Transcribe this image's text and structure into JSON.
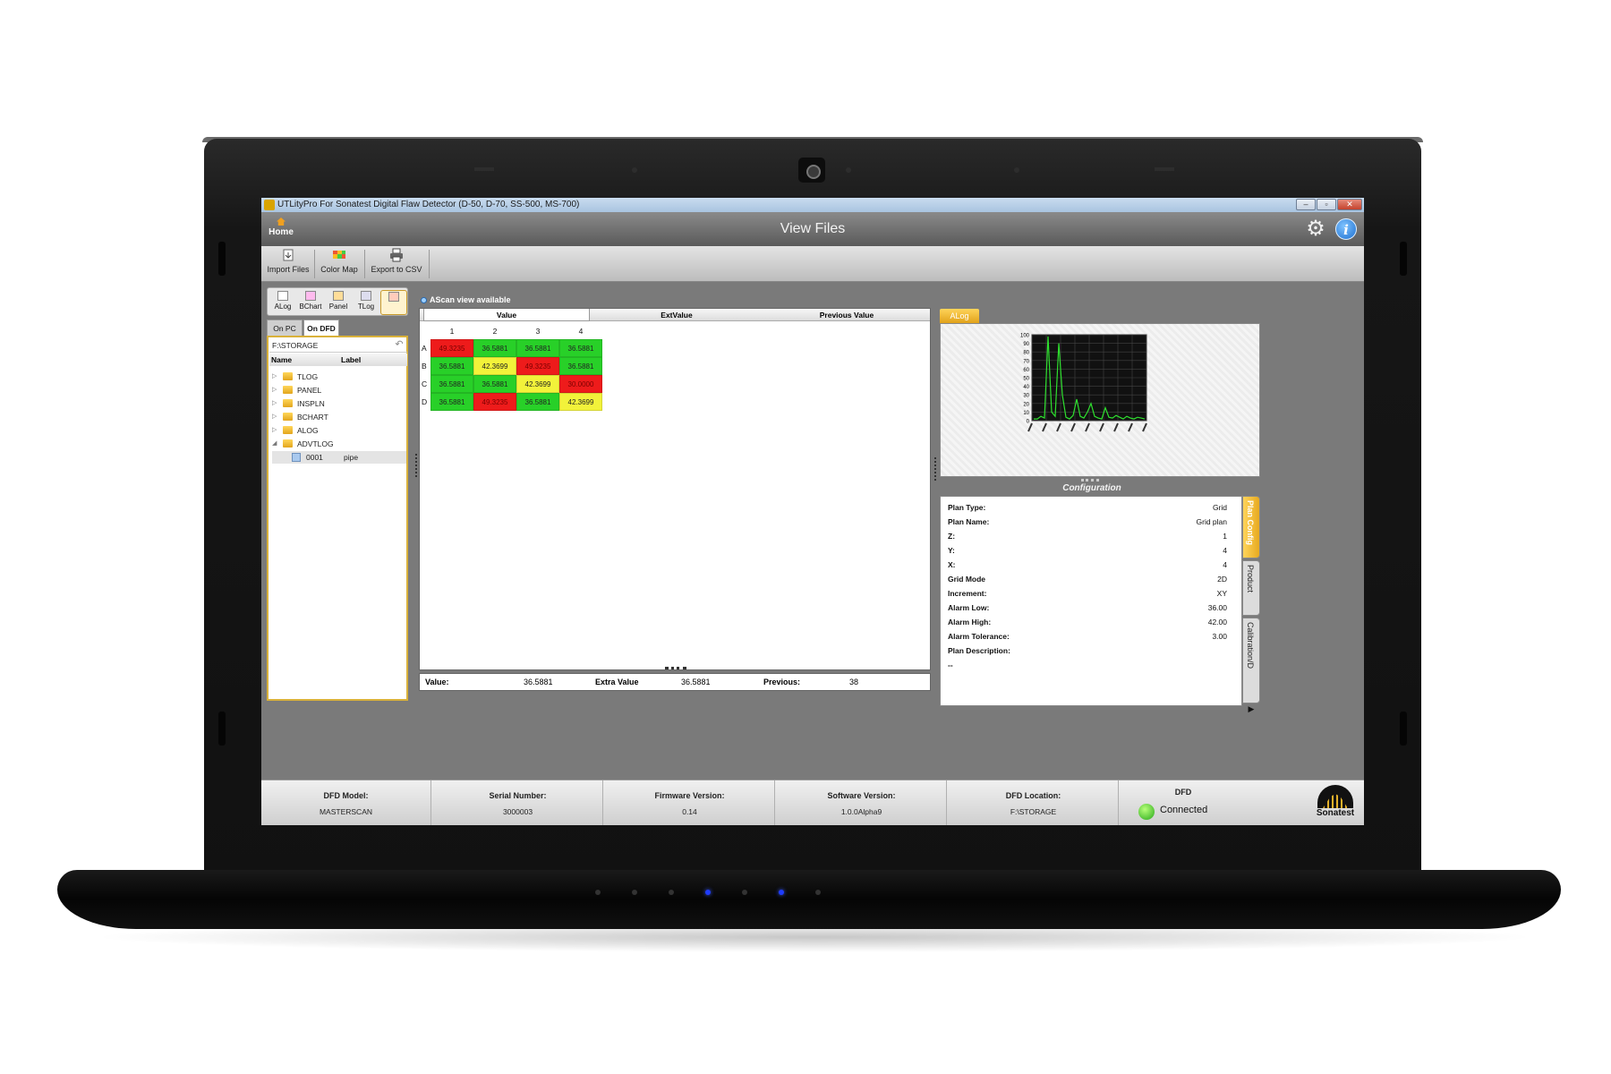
{
  "window": {
    "title": "UTLityPro For Sonatest Digital Flaw Detector (D-50, D-70, SS-500, MS-700)",
    "controls": [
      "–",
      "▫",
      "✕"
    ]
  },
  "header": {
    "home_label": "Home",
    "page_title": "View Files",
    "gear_icon": "gear-icon",
    "info_icon": "i"
  },
  "toolbar": {
    "import_files": "Import Files",
    "color_map": "Color Map",
    "export_csv": "Export to CSV"
  },
  "file_types": [
    "ALog",
    "BChart",
    "Panel",
    "TLog",
    "AdvTLog"
  ],
  "source_tabs": [
    "On PC",
    "On DFD"
  ],
  "active_source_tab": "On DFD",
  "browser": {
    "path": "F:\\STORAGE",
    "columns": [
      "Name",
      "Label"
    ],
    "folders": [
      "TLOG",
      "PANEL",
      "INSPLN",
      "BCHART",
      "ALOG",
      "ADVTLOG"
    ],
    "expanded_folder": "ADVTLOG",
    "file": {
      "name": "0001",
      "label": "pipe"
    }
  },
  "ascan_note": "AScan view available",
  "grid": {
    "columns": [
      "Value",
      "ExtValue",
      "Previous Value"
    ],
    "active_column": "Value",
    "col_numbers": [
      "1",
      "2",
      "3",
      "4"
    ],
    "row_labels": [
      "A",
      "B",
      "C",
      "D"
    ],
    "rows": [
      [
        {
          "v": "49.3235",
          "c": "red"
        },
        {
          "v": "36.5881",
          "c": "green"
        },
        {
          "v": "36.5881",
          "c": "green"
        },
        {
          "v": "36.5881",
          "c": "green"
        }
      ],
      [
        {
          "v": "36.5881",
          "c": "green"
        },
        {
          "v": "42.3699",
          "c": "yellow"
        },
        {
          "v": "49.3235",
          "c": "red"
        },
        {
          "v": "36.5881",
          "c": "green"
        }
      ],
      [
        {
          "v": "36.5881",
          "c": "green"
        },
        {
          "v": "36.5881",
          "c": "green"
        },
        {
          "v": "42.3699",
          "c": "yellow"
        },
        {
          "v": "30.0000",
          "c": "red"
        }
      ],
      [
        {
          "v": "36.5881",
          "c": "green"
        },
        {
          "v": "49.3235",
          "c": "red"
        },
        {
          "v": "36.5881",
          "c": "green"
        },
        {
          "v": "42.3699",
          "c": "yellow"
        }
      ]
    ],
    "colors": {
      "green": "#28d028",
      "red": "#ee1b1b",
      "yellow": "#f2f23a"
    }
  },
  "status_line": {
    "value_label": "Value:",
    "value": "36.5881",
    "extra_label": "Extra Value",
    "extra": "36.5881",
    "previous_label": "Previous:",
    "previous": "38"
  },
  "alog": {
    "tab_label": "ALog",
    "y_ticks": [
      "100",
      "90",
      "80",
      "70",
      "60",
      "50",
      "40",
      "30",
      "20",
      "10",
      "0"
    ]
  },
  "config": {
    "title": "Configuration",
    "rows": [
      {
        "k": "Plan Type:",
        "v": "Grid"
      },
      {
        "k": "Plan Name:",
        "v": "Grid plan"
      },
      {
        "k": "Z:",
        "v": "1"
      },
      {
        "k": "Y:",
        "v": "4"
      },
      {
        "k": "X:",
        "v": "4"
      },
      {
        "k": "Grid Mode",
        "v": "2D"
      },
      {
        "k": "Increment:",
        "v": "XY"
      },
      {
        "k": "Alarm Low:",
        "v": "36.00"
      },
      {
        "k": "Alarm High:",
        "v": "42.00"
      },
      {
        "k": "Alarm Tolerance:",
        "v": "3.00"
      },
      {
        "k": "Plan Description:",
        "v": ""
      },
      {
        "k": "--",
        "v": ""
      }
    ],
    "side_tabs": [
      "Plan Config",
      "Product",
      "Calibration/D"
    ],
    "side_more": "▶"
  },
  "footer": {
    "cells": [
      {
        "label": "DFD Model:",
        "value": "MASTERSCAN"
      },
      {
        "label": "Serial Number:",
        "value": "3000003"
      },
      {
        "label": "Firmware Version:",
        "value": "0.14"
      },
      {
        "label": "Software Version:",
        "value": "1.0.0Alpha9"
      },
      {
        "label": "DFD Location:",
        "value": "F:\\STORAGE"
      }
    ],
    "dfd_label": "DFD",
    "connection_status": "Connected",
    "brand": "Sonatest"
  }
}
